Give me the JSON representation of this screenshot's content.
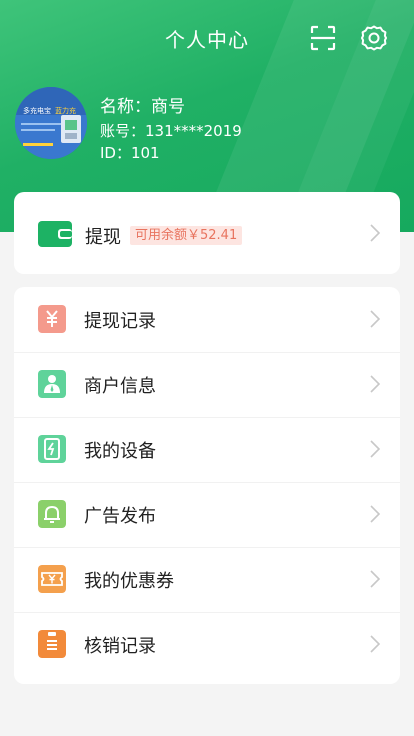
{
  "header": {
    "title": "个人中心",
    "scan_icon": "scan-icon",
    "settings_icon": "gear-icon"
  },
  "profile": {
    "avatar_text_1": "多充电宝",
    "avatar_text_2": "蓝力充",
    "name_line": "名称：商号",
    "account_line": "账号：131****2019",
    "id_line": "ID：101"
  },
  "withdraw": {
    "label": "提现",
    "balance": "可用余额￥52.41"
  },
  "menu": {
    "items": [
      {
        "label": "提现记录",
        "icon": "yuan-receipt-icon",
        "color": "#f49a8c"
      },
      {
        "label": "商户信息",
        "icon": "merchant-icon",
        "color": "#5fd39a"
      },
      {
        "label": "我的设备",
        "icon": "device-icon",
        "color": "#5fd39a"
      },
      {
        "label": "广告发布",
        "icon": "bell-icon",
        "color": "#8bd06a"
      },
      {
        "label": "我的优惠券",
        "icon": "coupon-icon",
        "color": "#f4a04d"
      },
      {
        "label": "核销记录",
        "icon": "clipboard-icon",
        "color": "#f28a3a"
      }
    ]
  },
  "colors": {
    "brand_green": "#1db264",
    "badge_bg": "#fde5e1",
    "badge_text": "#e8745f"
  }
}
